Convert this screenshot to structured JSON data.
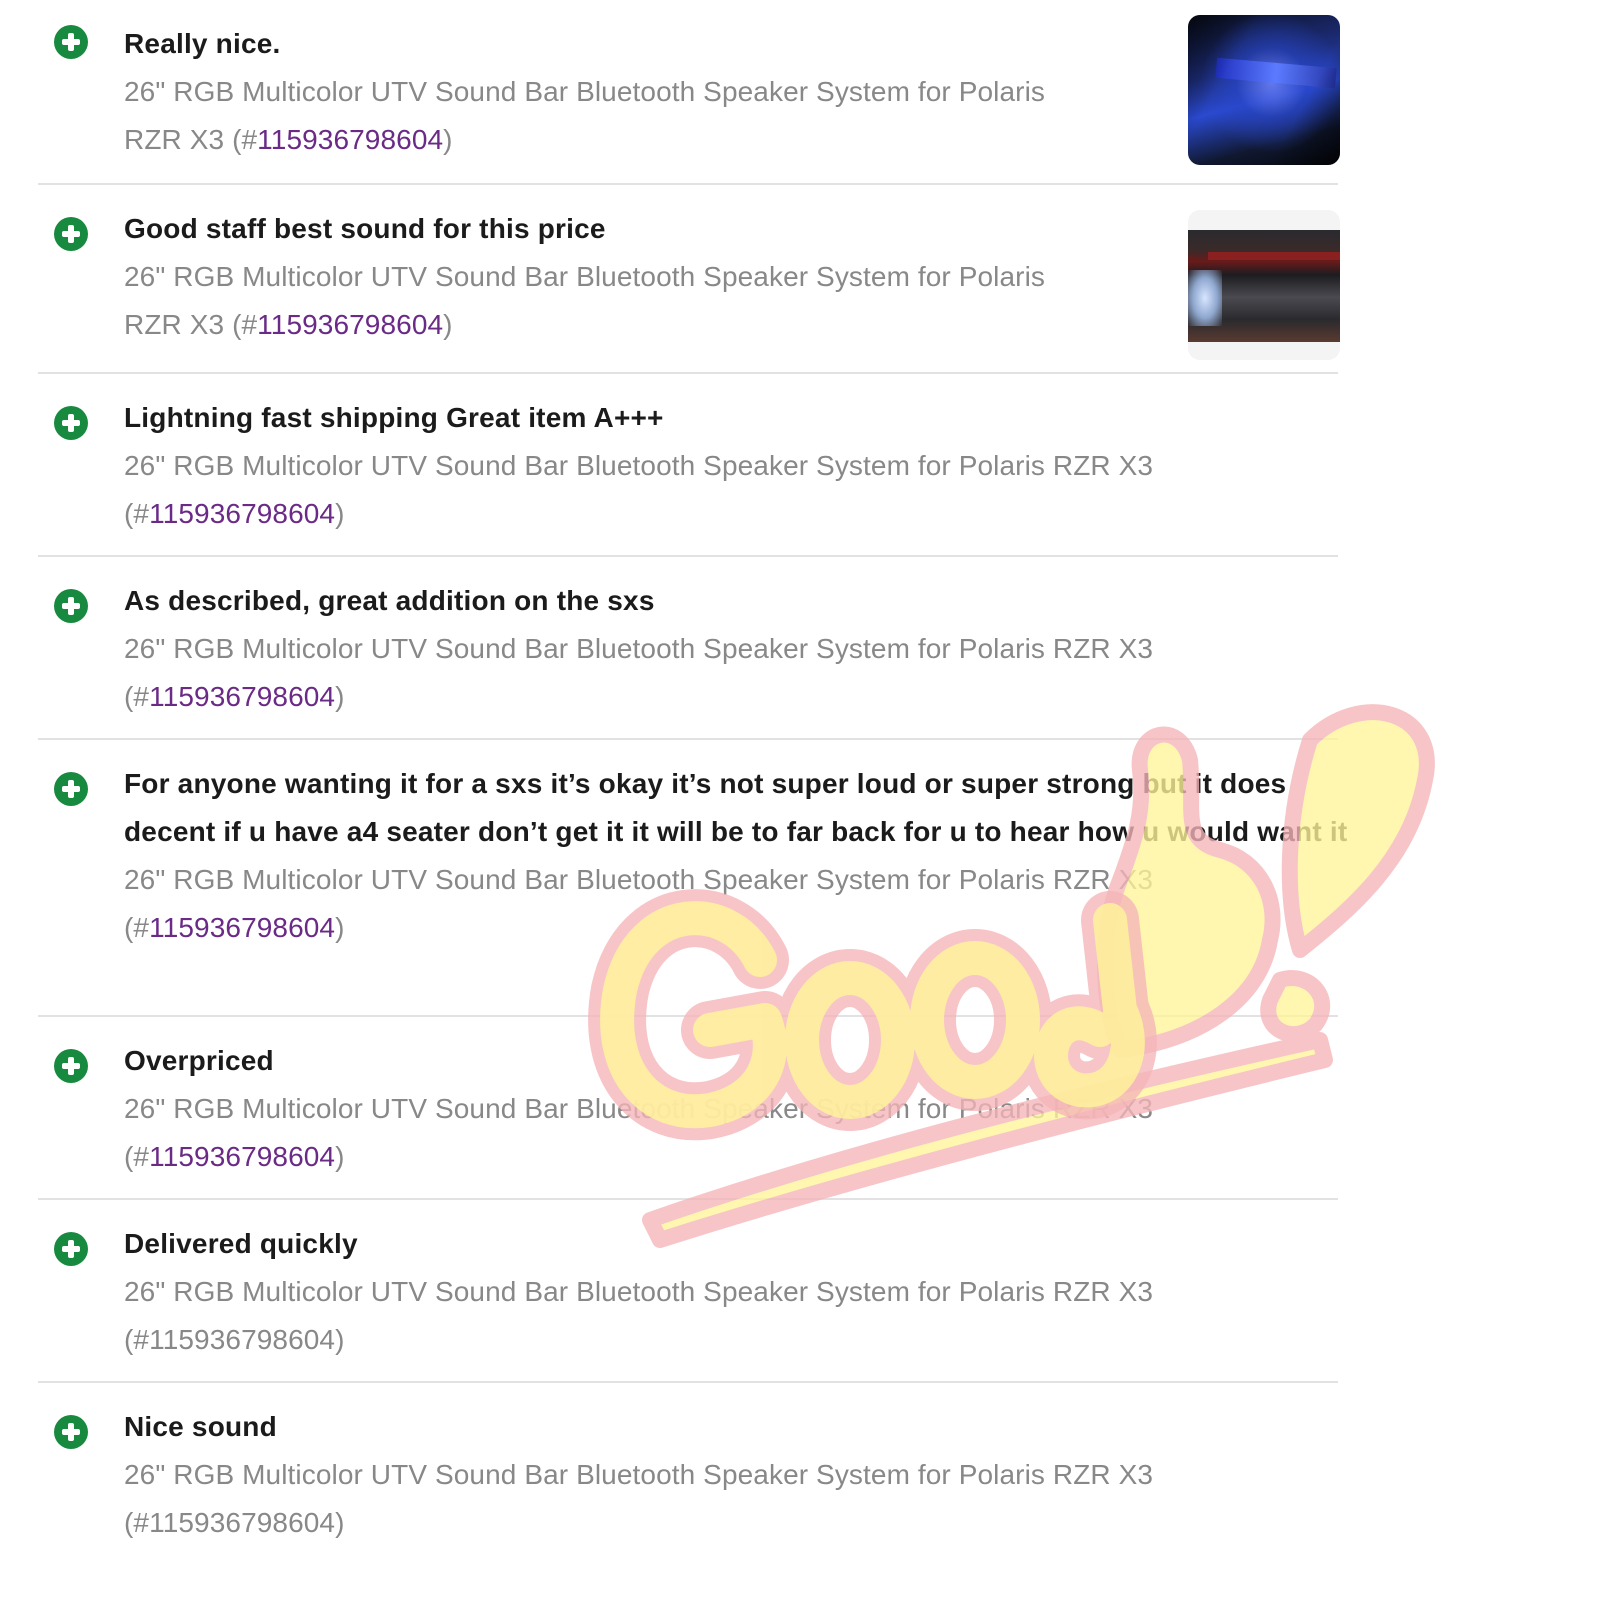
{
  "feedback": [
    {
      "comment": "Really nice.",
      "title": "26\" RGB Multicolor UTV Sound Bar Bluetooth Speaker System for Polaris RZR X3",
      "item_number": "115936798604",
      "has_photo": true
    },
    {
      "comment": "Good staff best sound for this price",
      "title": "26\" RGB Multicolor UTV Sound Bar Bluetooth Speaker System for Polaris RZR X3",
      "item_number": "115936798604",
      "has_photo": true
    },
    {
      "comment": "Lightning fast shipping Great item A+++",
      "title": "26\" RGB Multicolor UTV Sound Bar Bluetooth Speaker System for Polaris RZR X3",
      "item_number": "115936798604",
      "has_photo": false
    },
    {
      "comment": "As described, great addition on the sxs",
      "title": "26\" RGB Multicolor UTV Sound Bar Bluetooth Speaker System for Polaris RZR X3",
      "item_number": "115936798604",
      "has_photo": false
    },
    {
      "comment": "For anyone wanting it for a sxs it’s okay it’s not super loud or super strong but it does decent if u have a4 seater don’t get it it will be to far back for u to hear how u would want it",
      "title": "26\" RGB Multicolor UTV Sound Bar Bluetooth Speaker System for Polaris RZR X3",
      "item_number": "115936798604",
      "has_photo": false
    },
    {
      "comment": "Overpriced",
      "title": "26\" RGB Multicolor UTV Sound Bar Bluetooth Speaker System for Polaris RZR X3",
      "item_number": "115936798604",
      "has_photo": false
    },
    {
      "comment": "Delivered quickly",
      "title": "26\" RGB Multicolor UTV Sound Bar Bluetooth Speaker System for Polaris RZR X3",
      "item_number": "115936798604",
      "has_photo": false
    },
    {
      "comment": "Nice sound",
      "title": "26\" RGB Multicolor UTV Sound Bar Bluetooth Speaker System for Polaris RZR X3",
      "item_number": "115936798604",
      "has_photo": false
    }
  ],
  "rating_icon": "positive-plus-icon",
  "watermark_text": "Good!",
  "colors": {
    "positive": "#188a40",
    "item_link": "#6a2a86",
    "secondary_text": "#888888",
    "comment_text": "#1b1b1b",
    "divider": "#e2e2e2",
    "watermark_fill": "#fff59a",
    "watermark_outline": "#f5b5b8"
  }
}
